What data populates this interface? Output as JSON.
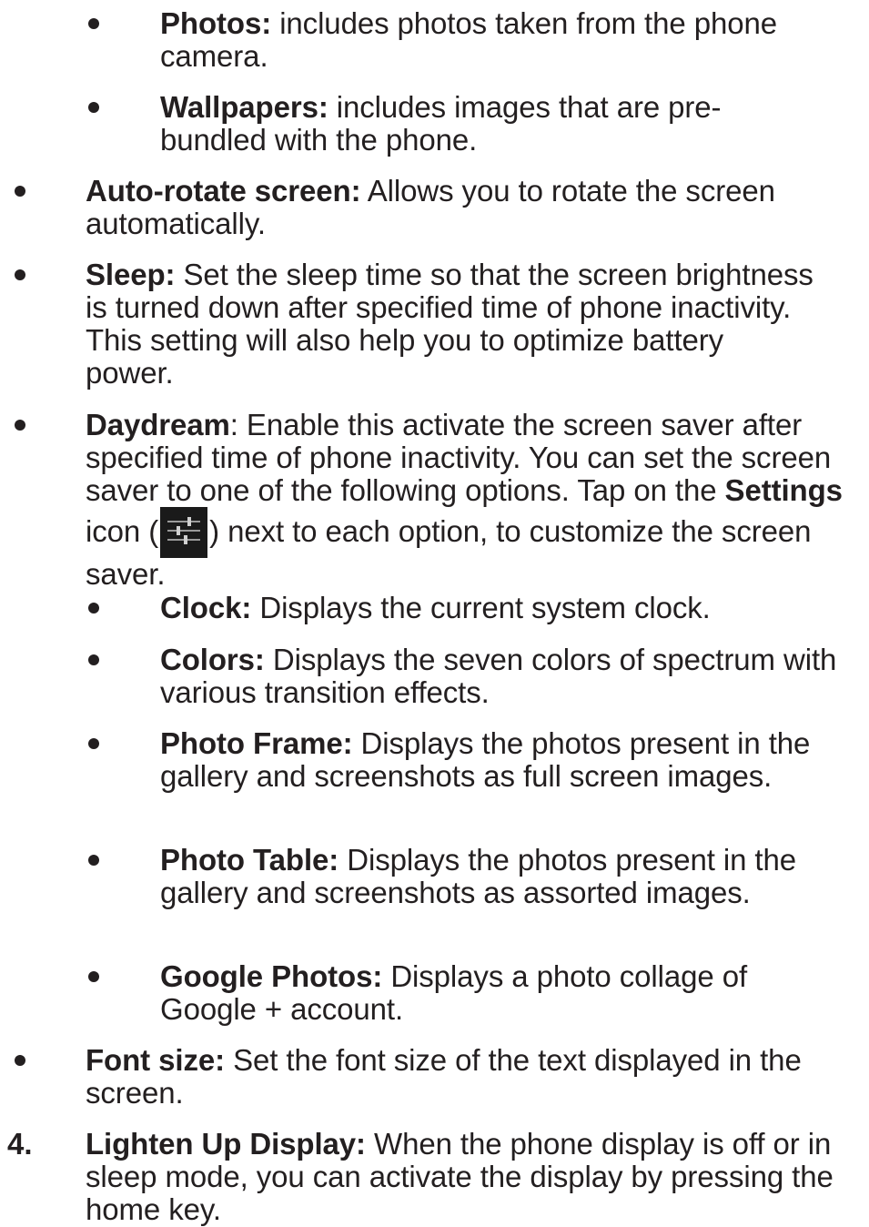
{
  "items": [
    {
      "label": "Photos:",
      "text": " includes photos taken from the phone camera."
    },
    {
      "label": "Wallpapers:",
      "text": " includes images that are pre-bundled with the phone."
    },
    {
      "label": "Auto-rotate screen:",
      "text": " Allows you to rotate the screen automatically."
    },
    {
      "label": "Sleep:",
      "text": " Set the sleep time so that the screen brightness is turned down after specified time of phone inactivity. This setting will also help you to optimize battery power."
    },
    {
      "label": "Daydream",
      "text_a": ": Enable this activate the screen saver after specified time of phone inactivity. You can set the screen saver to one of the following options. Tap on the ",
      "settings_word": "Settings",
      "text_b": " icon (",
      "text_c": ") next to each option, to customize the screen saver.",
      "icon": "settings-sliders-icon"
    },
    {
      "label": "Clock:",
      "text": " Displays the current system clock."
    },
    {
      "label": "Colors:",
      "text": " Displays the seven colors of spectrum with various transition effects."
    },
    {
      "label": "Photo Frame:",
      "text": " Displays the photos present in the gallery and screenshots as full screen images."
    },
    {
      "label": "Photo Table:",
      "text": " Displays the photos present in the gallery and screenshots as assorted images."
    },
    {
      "label": "Google Photos:",
      "text": " Displays a photo collage of Google + account."
    },
    {
      "label": "Font size:",
      "text": " Set the font size of the text displayed in the screen."
    },
    {
      "number": "4.",
      "label": "Lighten Up Display:",
      "text": " When the phone display is off or in sleep mode, you can activate the display by pressing the home key."
    }
  ]
}
